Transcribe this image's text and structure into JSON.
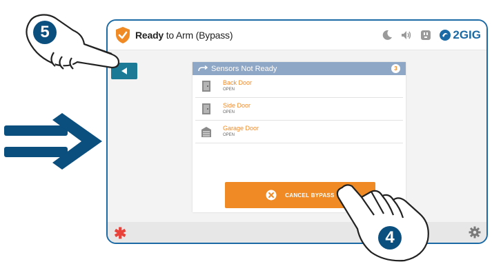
{
  "header": {
    "status_bold": "Ready",
    "status_rest": " to Arm (Bypass)",
    "brand": "2GIG"
  },
  "sensors_card": {
    "title": "Sensors Not Ready",
    "count": "3",
    "items": [
      {
        "name": "Back Door",
        "state": "OPEN",
        "icon": "door-icon"
      },
      {
        "name": "Side Door",
        "state": "OPEN",
        "icon": "door-icon"
      },
      {
        "name": "Garage Door",
        "state": "OPEN",
        "icon": "garage-door-icon"
      }
    ]
  },
  "cancel_button": {
    "label": "CANCEL BYPASS"
  },
  "steps": {
    "step_back": "5",
    "step_cancel": "4"
  },
  "colors": {
    "accent_orange": "#f08a24",
    "header_blue": "#8fa7c6",
    "back_button_teal": "#1b7a96",
    "frame_blue": "#1b6aa5",
    "badge_navy": "#0b4f7e",
    "emergency_red": "#e8423a"
  }
}
